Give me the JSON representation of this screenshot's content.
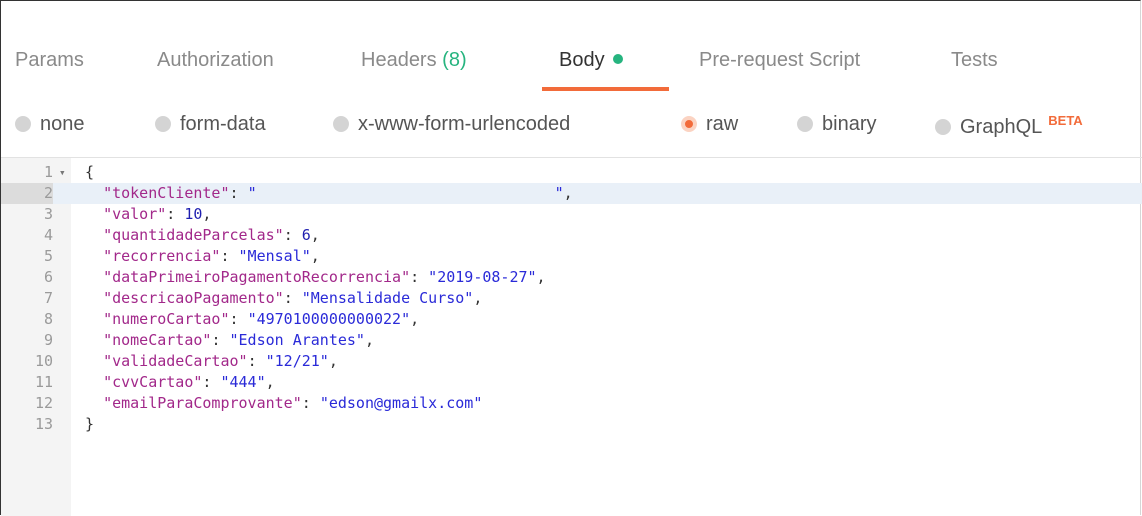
{
  "tabs": [
    {
      "label": "Params"
    },
    {
      "label": "Authorization"
    },
    {
      "label": "Headers",
      "count": "(8)"
    },
    {
      "label": "Body"
    },
    {
      "label": "Pre-request Script"
    },
    {
      "label": "Tests"
    }
  ],
  "body_types": [
    {
      "label": "none"
    },
    {
      "label": "form-data"
    },
    {
      "label": "x-www-form-urlencoded"
    },
    {
      "label": "raw"
    },
    {
      "label": "binary"
    },
    {
      "label": "GraphQL",
      "badge": "BETA"
    }
  ],
  "colors": {
    "accent": "#f26b3a",
    "status_dot": "#26b47f",
    "string": "#2a2ad8",
    "key": "#a2288a"
  },
  "editor": {
    "lines": [
      {
        "n": "1",
        "open": "{"
      },
      {
        "n": "2",
        "key": "\"tokenCliente\"",
        "value": "\"                                 \"",
        "comma": ","
      },
      {
        "n": "3",
        "key": "\"valor\"",
        "value": "10",
        "comma": ","
      },
      {
        "n": "4",
        "key": "\"quantidadeParcelas\"",
        "value": "6",
        "comma": ","
      },
      {
        "n": "5",
        "key": "\"recorrencia\"",
        "value": "\"Mensal\"",
        "comma": ","
      },
      {
        "n": "6",
        "key": "\"dataPrimeiroPagamentoRecorrencia\"",
        "value": "\"2019-08-27\"",
        "comma": ","
      },
      {
        "n": "7",
        "key": "\"descricaoPagamento\"",
        "value": "\"Mensalidade Curso\"",
        "comma": ","
      },
      {
        "n": "8",
        "key": "\"numeroCartao\"",
        "value": "\"4970100000000022\"",
        "comma": ","
      },
      {
        "n": "9",
        "key": "\"nomeCartao\"",
        "value": "\"Edson Arantes\"",
        "comma": ","
      },
      {
        "n": "10",
        "key": "\"validadeCartao\"",
        "value": "\"12/21\"",
        "comma": ","
      },
      {
        "n": "11",
        "key": "\"cvvCartao\"",
        "value": "\"444\"",
        "comma": ","
      },
      {
        "n": "12",
        "key": "\"emailParaComprovante\"",
        "value": "\"edson@gmailx.com\"",
        "comma": ""
      },
      {
        "n": "13",
        "close": "}"
      }
    ]
  }
}
